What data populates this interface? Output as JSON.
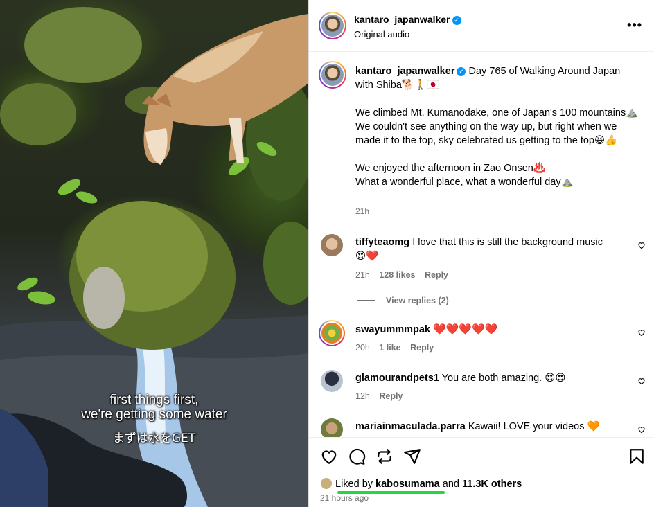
{
  "media": {
    "caption_line1": "first things first,",
    "caption_line2": "we're getting some water",
    "caption_line3": "まずは水をGET"
  },
  "header": {
    "username": "kantaro_japanwalker",
    "audio": "Original audio",
    "more_icon": "more-horizontal-icon"
  },
  "post": {
    "username": "kantaro_japanwalker",
    "line1": "Day 765 of Walking Around Japan with Shiba🐕🚶🇯🇵",
    "para2": "We climbed Mt. Kumanodake, one of Japan's 100 mountains⛰️ We couldn't see anything on the way up, but right when we made it to the top, sky celebrated us getting to the top😆👍",
    "para3_line1": "We enjoyed the afternoon in Zao Onsen♨️",
    "para3_line2": "What a wonderful place, what a wonderful day⛰️",
    "time": "21h"
  },
  "comments": [
    {
      "username": "tiffyteaomg",
      "text": "I love that this is still the background music",
      "emoji_line": "😍❤️",
      "time": "21h",
      "likes": "128 likes",
      "reply": "Reply",
      "view_replies": "View replies (2)"
    },
    {
      "username": "swayummmpak",
      "text": "❤️❤️❤️❤️❤️",
      "time": "20h",
      "likes": "1 like",
      "reply": "Reply"
    },
    {
      "username": "glamourandpets1",
      "text": "You are both amazing. 😍😍",
      "time": "12h",
      "reply": "Reply"
    },
    {
      "username": "mariainmaculada.parra",
      "text": "Kawaii! LOVE your videos 🧡"
    }
  ],
  "actions": {
    "like_icon": "heart-icon",
    "comment_icon": "comment-icon",
    "repost_icon": "repost-icon",
    "share_icon": "share-icon",
    "save_icon": "bookmark-icon",
    "liked_by_prefix": "Liked by",
    "liked_by_user": "kabosumama",
    "liked_by_and": "and",
    "liked_by_others": "11.3K others",
    "posted_ago": "21 hours ago"
  },
  "colors": {
    "verified": "#0095f6",
    "muted_text": "#737373",
    "highlight_underline": "#22d83a"
  }
}
